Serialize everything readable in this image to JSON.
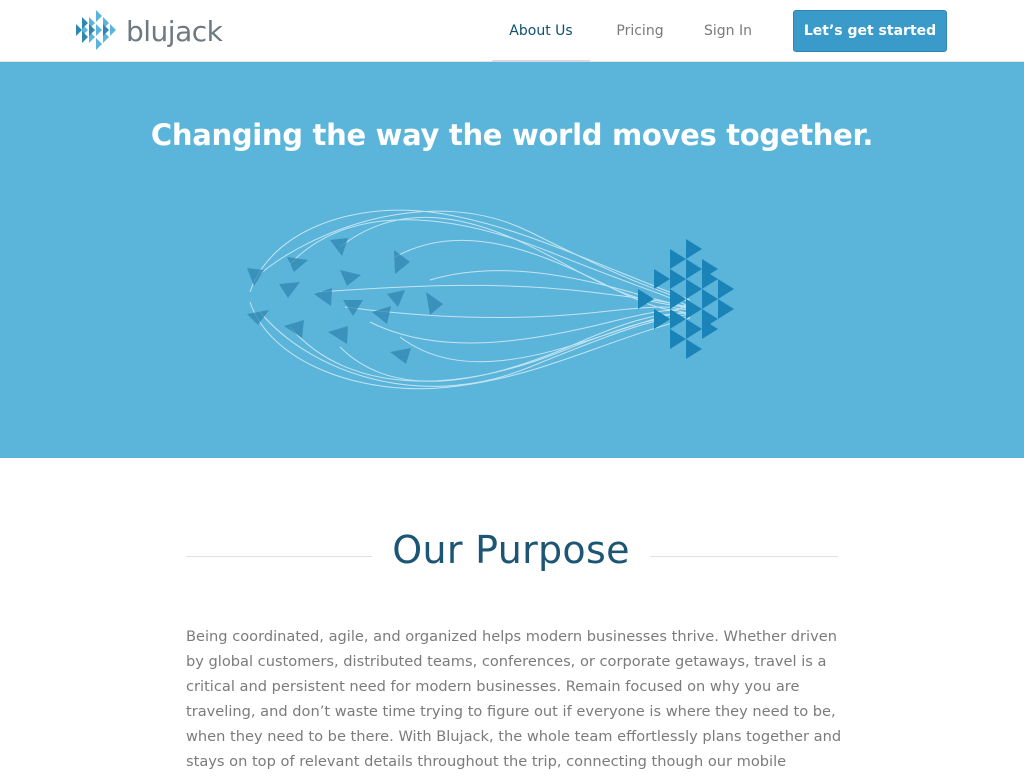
{
  "header": {
    "brand_name": "blujack",
    "nav": [
      {
        "label": "About Us",
        "active": true
      },
      {
        "label": "Pricing",
        "active": false
      },
      {
        "label": "Sign In",
        "active": false
      }
    ],
    "cta_label": "Let’s get started"
  },
  "hero": {
    "title": "Changing the way the world moves together.",
    "illustration": "scattered-triangles-converging-into-logo"
  },
  "purpose": {
    "title": "Our Purpose",
    "body": "Being coordinated, agile, and organized helps modern businesses thrive. Whether driven by global customers, distributed teams, conferences, or corporate getaways, travel is a critical and persistent need for modern businesses. Remain focused on why you are traveling, and don’t waste time trying to figure out if everyone is where they need to be, when they need to be there. With Blujack, the whole team effortlessly plans together and stays on top of relevant details throughout the trip, connecting though our mobile application or website."
  },
  "colors": {
    "accent": "#3a9bcb",
    "hero_bg": "#5bb5da",
    "heading": "#1d5675",
    "nav_active": "#0e4f72"
  }
}
